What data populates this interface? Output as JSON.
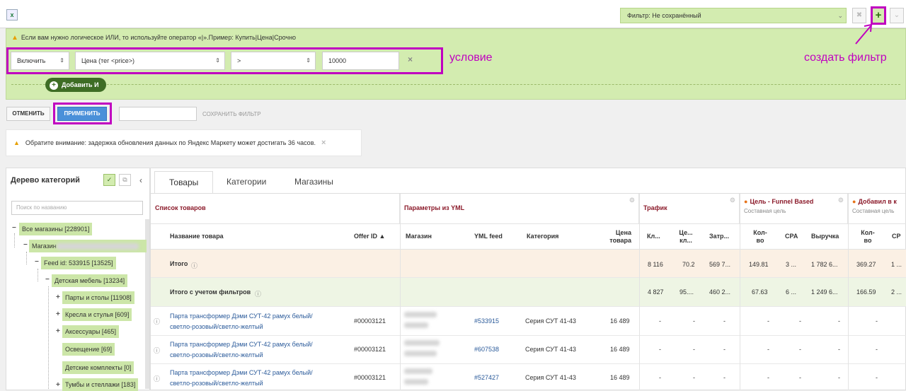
{
  "filter": {
    "title": "Фильтр: Не сохранённый",
    "hint": "Если вам нужно логическое ИЛИ, то используйте оператор «|».Пример: Купить|Цена|Срочно",
    "condition": {
      "mode": "Включить",
      "field": "Цена (тег <price>)",
      "operator": ">",
      "value": "10000"
    },
    "add_and": "Добавить И",
    "cancel": "ОТМЕНИТЬ",
    "apply": "ПРИМЕНИТЬ",
    "save": "СОХРАНИТЬ ФИЛЬТР",
    "add_icon": "+",
    "close_icon": "×"
  },
  "annotations": {
    "condition": "условие",
    "create_filter": "создать фильтр"
  },
  "notice": "Обратите внимание: задержка обновления данных по Яндекс Маркету может достигать 36 часов.",
  "tree": {
    "title": "Дерево категорий",
    "search_placeholder": "Поиск по названию",
    "nodes": [
      "Все магазины [228901]",
      "Магазин",
      "Feed id: 533915 [13525]",
      "Детская мебель [13234]",
      "Парты и столы [11908]",
      "Кресла и стулья [609]",
      "Аксессуары [465]",
      "Освещение [69]",
      "Детские комплекты [0]",
      "Тумбы и стеллажи [183]"
    ]
  },
  "tabs": [
    "Товары",
    "Категории",
    "Магазины"
  ],
  "groups": {
    "products": "Список товаров",
    "yml": "Параметры из YML",
    "traffic": "Трафик",
    "goal": "Цель - Funnel Based",
    "goal_sub": "Составная цель",
    "cart": "Добавил в к",
    "cart_sub": "Составная цель"
  },
  "columns": {
    "name": "Название товара",
    "offer": "Offer ID",
    "shop": "Магазин",
    "feed": "YML feed",
    "category": "Категория",
    "price": "Цена товара",
    "clicks": "Кл...",
    "cpc": "Це... кл...",
    "cost": "Затр...",
    "qty": "Кол-во",
    "cpa": "CPA",
    "revenue": "Выручка",
    "qty2": "Кол-во",
    "cpa2": "СР"
  },
  "totals": {
    "label": "Итого",
    "vals": [
      "8 116",
      "70.2",
      "569 7...",
      "149.81",
      "3 ...",
      "1 782 6...",
      "369.27",
      "1 ..."
    ]
  },
  "totals_filtered": {
    "label": "Итого с учетом фильтров",
    "vals": [
      "4 827",
      "95....",
      "460 2...",
      "67.63",
      "6 ...",
      "1 249 6...",
      "166.59",
      "2 ..."
    ]
  },
  "rows": [
    {
      "name1": "Парта трансформер Дэми СУТ-42 рамух белый/",
      "name2": "светло-розовый/светло-желтый",
      "offer": "#00003121",
      "feed": "#533915",
      "category": "Серия СУТ 41-43",
      "price": "16 489"
    },
    {
      "name1": "Парта трансформер Дэми СУТ-42 рамух белый/",
      "name2": "светло-розовый/светло-желтый",
      "offer": "#00003121",
      "feed": "#607538",
      "category": "Серия СУТ 41-43",
      "price": "16 489"
    },
    {
      "name1": "Парта трансформер Дэми СУТ-42 рамух белый/",
      "name2": "светло-розовый/светло-желтый",
      "offer": "#00003121",
      "feed": "#527427",
      "category": "Серия СУТ 41-43",
      "price": "16 489"
    }
  ],
  "dash": "-"
}
